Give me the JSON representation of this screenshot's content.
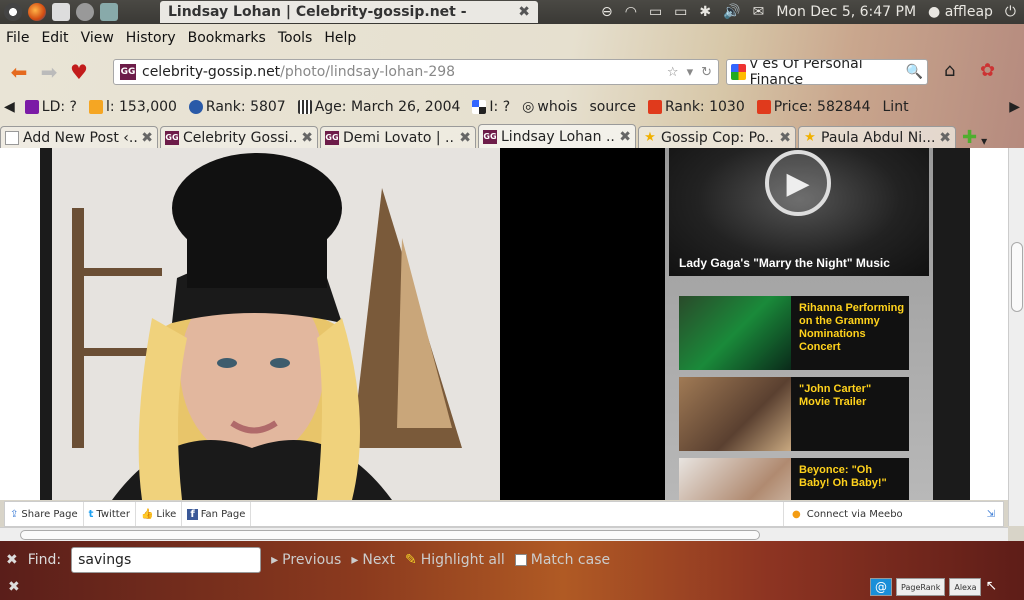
{
  "panel": {
    "window_title": "Lindsay Lohan | Celebrity-gossip.net - Mozil...",
    "clock": "Mon Dec  5,  6:47 PM",
    "user": "affleap"
  },
  "menu": [
    "File",
    "Edit",
    "View",
    "History",
    "Bookmarks",
    "Tools",
    "Help"
  ],
  "nav": {
    "url_host": "celebrity-gossip.net",
    "url_path": "/photo/lindsay-lohan-298",
    "search_value": "v es Of Personal Finance"
  },
  "addon_bar": {
    "ld": "LD: ?",
    "links": "l: 153,000",
    "rank": "Rank: 5807",
    "age": "Age: March 26, 2004",
    "indexed": "I: ?",
    "whois": "whois",
    "source": "source",
    "rank2": "Rank: 1030",
    "price": "Price: 582844",
    "more": "Lint"
  },
  "tabs": [
    {
      "label": "Add New Post ‹..."
    },
    {
      "label": "Celebrity Gossi..."
    },
    {
      "label": "Demi Lovato | ..."
    },
    {
      "label": "Lindsay Lohan ..."
    },
    {
      "label": "Gossip Cop: Po..."
    },
    {
      "label": "Paula Abdul Ni..."
    }
  ],
  "content": {
    "video_title": "Lady Gaga's \"Marry the Night\" Music",
    "stories": [
      {
        "title": "Rihanna Performing on the Grammy Nominations Concert"
      },
      {
        "title": "\"John Carter\" Movie Trailer"
      },
      {
        "title": "Beyonce: \"Oh Baby! Oh Baby!\""
      }
    ]
  },
  "share_bar": {
    "share": "Share Page",
    "twitter": "Twitter",
    "like": "Like",
    "fan": "Fan Page",
    "meebo": "Connect via Meebo"
  },
  "find_bar": {
    "label": "Find:",
    "value": "savings",
    "previous": "Previous",
    "next": "Next",
    "highlight": "Highlight all",
    "match_case": "Match case"
  },
  "status": {
    "pagerank": "PageRank",
    "alexa": "Alexa"
  }
}
